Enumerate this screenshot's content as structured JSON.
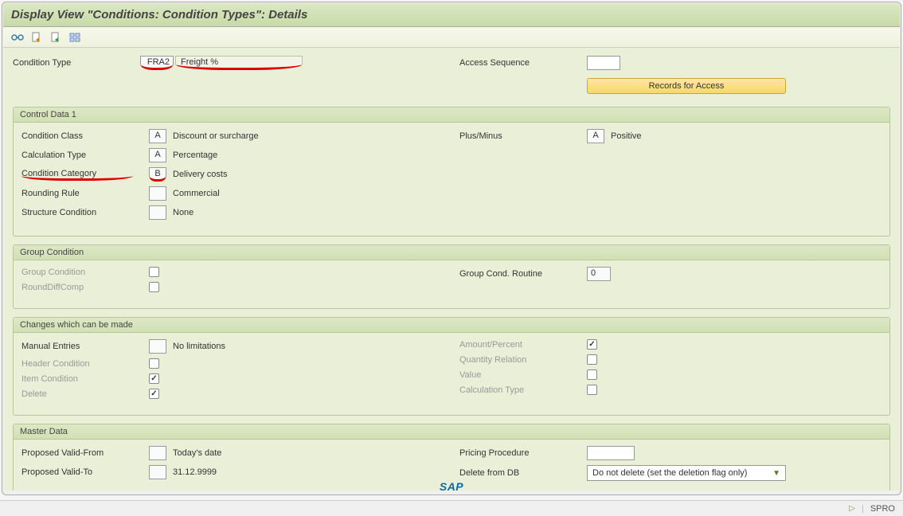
{
  "header": {
    "title": "Display View \"Conditions: Condition Types\": Details"
  },
  "toolbar": {
    "icons": [
      "glasses-icon",
      "page-arrow-icon",
      "page-plus-icon",
      "grid-icon"
    ]
  },
  "top": {
    "cond_type_label": "Condition Type",
    "cond_type_code": "FRA2",
    "cond_type_desc": "Freight %",
    "access_seq_label": "Access Sequence",
    "access_seq_value": "",
    "records_btn": "Records for Access"
  },
  "control1": {
    "title": "Control Data 1",
    "rows": {
      "cond_class": {
        "label": "Condition Class",
        "code": "A",
        "desc": "Discount or surcharge"
      },
      "calc_type": {
        "label": "Calculation Type",
        "code": "A",
        "desc": "Percentage"
      },
      "cond_cat": {
        "label": "Condition Category",
        "code": "B",
        "desc": "Delivery costs"
      },
      "rounding": {
        "label": "Rounding Rule",
        "code": "",
        "desc": "Commercial"
      },
      "struct": {
        "label": "Structure Condition",
        "code": "",
        "desc": "None"
      },
      "plus_minus": {
        "label": "Plus/Minus",
        "code": "A",
        "desc": "Positive"
      }
    }
  },
  "group_cond": {
    "title": "Group Condition",
    "group_cond_label": "Group Condition",
    "round_diff_label": "RoundDiffComp",
    "routine_label": "Group Cond. Routine",
    "routine_value": "0"
  },
  "changes": {
    "title": "Changes which can be made",
    "manual_entries_label": "Manual Entries",
    "manual_entries_code": "",
    "manual_entries_desc": "No limitations",
    "header_cond_label": "Header Condition",
    "item_cond_label": "Item Condition",
    "delete_label": "Delete",
    "amount_label": "Amount/Percent",
    "qty_label": "Quantity Relation",
    "value_label": "Value",
    "calc_label": "Calculation Type"
  },
  "master": {
    "title": "Master Data",
    "valid_from_label": "Proposed Valid-From",
    "valid_from_desc": "Today's date",
    "valid_to_label": "Proposed Valid-To",
    "valid_to_desc": "31.12.9999",
    "pricing_label": "Pricing Procedure",
    "pricing_value": "",
    "delete_db_label": "Delete from DB",
    "delete_db_value": "Do not delete (set the deletion flag only)"
  },
  "status": {
    "tcode": "SPRO",
    "logo": "SAP"
  }
}
